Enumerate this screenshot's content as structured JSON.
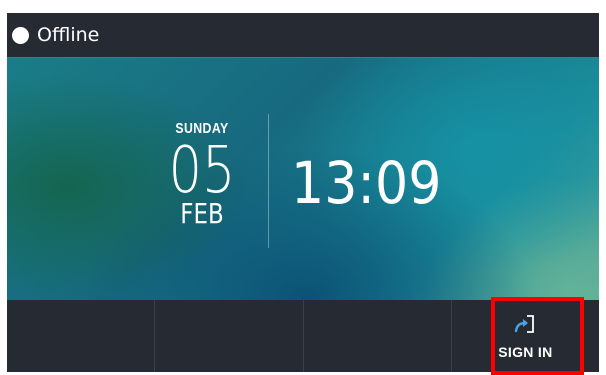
{
  "status": {
    "label": "Offline",
    "dot_color": "#ffffff"
  },
  "clock": {
    "day_name": "SUNDAY",
    "day_number": "05",
    "month": "FEB",
    "time": "13:09"
  },
  "bottom_bar": {
    "signin": {
      "label": "SIGN IN",
      "icon": "sign-in-icon",
      "icon_color": "#4ba3e6"
    }
  },
  "colors": {
    "bar_background": "#262a33",
    "highlight": "#ff0000"
  }
}
